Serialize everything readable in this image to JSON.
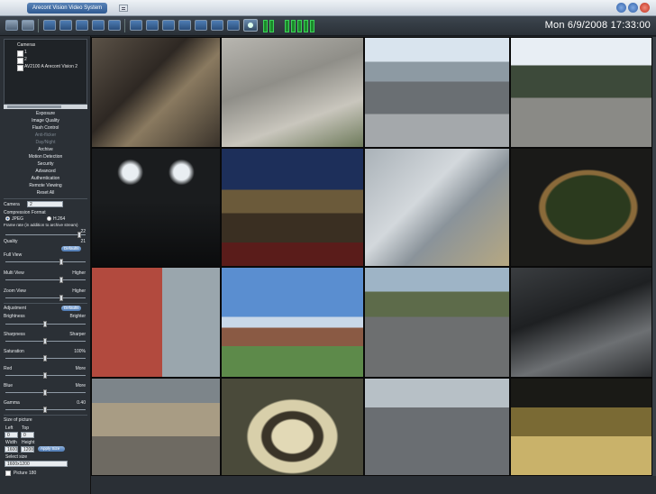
{
  "window": {
    "title": "Arecont Vision Video System",
    "clock": "Mon 6/9/2008 17:33:00"
  },
  "tree": {
    "root": "Cameras",
    "node_1": "1",
    "node_2": "2",
    "node_3": "AV2100 A  Arecont Vision 2"
  },
  "menu": {
    "items": [
      {
        "label": "Exposure",
        "dim": false
      },
      {
        "label": "Image Quality",
        "dim": false
      },
      {
        "label": "Flash Control",
        "dim": false
      },
      {
        "label": "Anti-flicker",
        "dim": true
      },
      {
        "label": "Day/Night",
        "dim": true
      },
      {
        "label": "Archive",
        "dim": false
      },
      {
        "label": "Motion Detection",
        "dim": false
      },
      {
        "label": "Security",
        "dim": false
      },
      {
        "label": "Advanced",
        "dim": false
      },
      {
        "label": "Authentication",
        "dim": false
      },
      {
        "label": "Remote Viewing",
        "dim": false
      },
      {
        "label": "Reset All",
        "dim": false
      }
    ]
  },
  "settings": {
    "camera_label": "Camera",
    "camera_value": "2",
    "compression_label": "Compression Format",
    "jpeg_label": "JPEG",
    "h264_label": "H.264",
    "frame_rate_label": "Frame rate (in addition to archive stream)",
    "frame_rate_value": "22",
    "quality_label": "Quality",
    "quality_value": "21",
    "defaults_label": "Defaults",
    "full_view_label": "Full View",
    "multi_view_label": "Multi View",
    "zoom_view_label": "Zoom View",
    "higher_label": "Higher",
    "adjustment_label": "Adjustment",
    "defaults2_label": "Defaults",
    "brightness_label": "Brightness",
    "brighter_label": "Brighter",
    "sharpness_label": "Sharpness",
    "sharper_label": "Sharper",
    "saturation_label": "Saturation",
    "saturation_value": "100%",
    "red_label": "Red",
    "blue_label": "Blue",
    "more_label": "More",
    "gamma_label": "Gamma",
    "gamma_value": "0.40",
    "size_label": "Size of picture",
    "left_label": "Left",
    "top_label": "Top",
    "left_value": "0",
    "top_value": "0",
    "width_label": "Width",
    "height_label": "Height",
    "width_value": "1600",
    "height_value": "1200",
    "apply_label": "Apply Size",
    "select_size_label": "Select size",
    "select_size_value": "1600x1200",
    "picture_label": "Picture 180"
  },
  "colors": {
    "accent": "#4b77b0",
    "panel_bg": "#2b3036",
    "meter_green": "#3dd25a"
  }
}
